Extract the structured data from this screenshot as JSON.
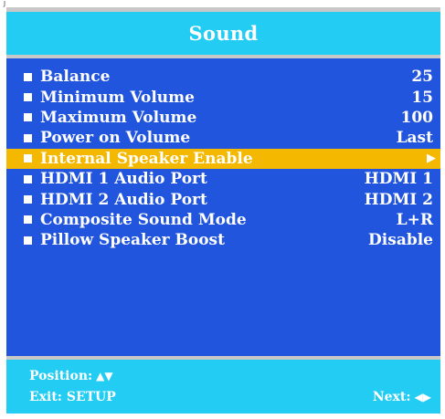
{
  "osd": {
    "corner_mark": "J",
    "title": "Sound",
    "colors": {
      "header_bg": "#22ccf2",
      "panel_bg": "#2255dd",
      "highlight_bg": "#f5b800",
      "text": "#ffffff",
      "frame": "#c8c8c8"
    },
    "menu": {
      "items": [
        {
          "label": "Balance",
          "value": "25"
        },
        {
          "label": "Minimum Volume",
          "value": "15"
        },
        {
          "label": "Maximum Volume",
          "value": "100"
        },
        {
          "label": "Power on Volume",
          "value": "Last"
        },
        {
          "label": "Internal Speaker Enable",
          "value": "▶",
          "selected": true
        },
        {
          "label": "HDMI 1 Audio Port",
          "value": "HDMI 1"
        },
        {
          "label": "HDMI 2 Audio Port",
          "value": "HDMI 2"
        },
        {
          "label": "Composite Sound Mode",
          "value": "L+R"
        },
        {
          "label": "Pillow Speaker Boost",
          "value": "Disable"
        }
      ]
    },
    "footer": {
      "position_label": "Position:",
      "position_glyphs": "▲▼",
      "exit_label": "Exit: SETUP",
      "next_label": "Next:",
      "next_glyphs": "◀▶"
    }
  }
}
